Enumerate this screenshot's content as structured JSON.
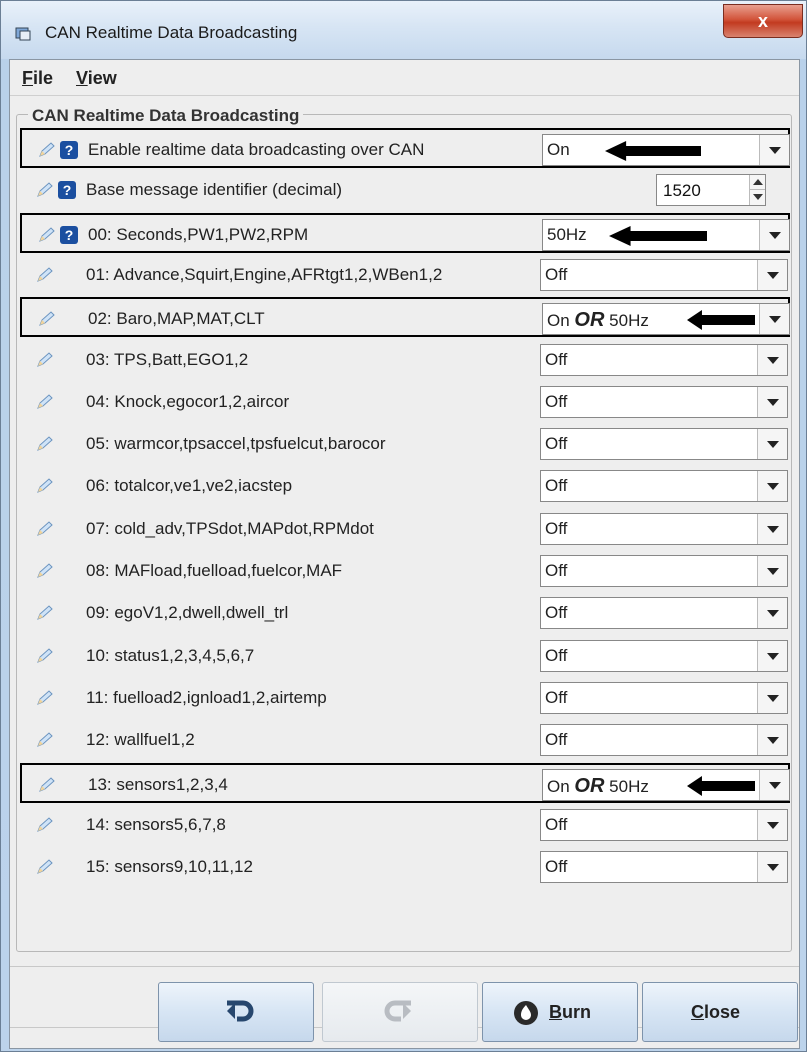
{
  "window": {
    "title": "CAN Realtime Data Broadcasting",
    "close_glyph": "x"
  },
  "menu": {
    "file": {
      "mnemonic": "F",
      "rest": "ile"
    },
    "view": {
      "mnemonic": "V",
      "rest": "iew"
    }
  },
  "section": {
    "title": "CAN Realtime Data Broadcasting"
  },
  "rows": [
    {
      "label": "Enable realtime data broadcasting over CAN",
      "value": "On",
      "has_help": true,
      "highlight": true
    },
    {
      "label": "Base message identifier (decimal)",
      "value": "1520",
      "has_help": true,
      "highlight": false,
      "spinner": true
    },
    {
      "label": "00: Seconds,PW1,PW2,RPM",
      "value": "50Hz",
      "has_help": true,
      "highlight": true
    },
    {
      "label": "01: Advance,Squirt,Engine,AFRtgt1,2,WBen1,2",
      "value": "Off"
    },
    {
      "label": "02: Baro,MAP,MAT,CLT",
      "value_a": "On",
      "value_or": "OR",
      "value_b": "50Hz",
      "highlight": true
    },
    {
      "label": "03: TPS,Batt,EGO1,2",
      "value": "Off"
    },
    {
      "label": "04: Knock,egocor1,2,aircor",
      "value": "Off"
    },
    {
      "label": "05: warmcor,tpsaccel,tpsfuelcut,barocor",
      "value": "Off"
    },
    {
      "label": "06: totalcor,ve1,ve2,iacstep",
      "value": "Off"
    },
    {
      "label": "07: cold_adv,TPSdot,MAPdot,RPMdot",
      "value": "Off"
    },
    {
      "label": "08: MAFload,fuelload,fuelcor,MAF",
      "value": "Off"
    },
    {
      "label": "09: egoV1,2,dwell,dwell_trl",
      "value": "Off"
    },
    {
      "label": "10: status1,2,3,4,5,6,7",
      "value": "Off"
    },
    {
      "label": "11: fuelload2,ignload1,2,airtemp",
      "value": "Off"
    },
    {
      "label": "12: wallfuel1,2",
      "value": "Off"
    },
    {
      "label": "13: sensors1,2,3,4",
      "value_a": "On",
      "value_or": "OR",
      "value_b": "50Hz",
      "highlight": true
    },
    {
      "label": "14: sensors5,6,7,8",
      "value": "Off"
    },
    {
      "label": "15: sensors9,10,11,12",
      "value": "Off"
    }
  ],
  "buttons": {
    "burn": {
      "mnemonic": "B",
      "rest": "urn"
    },
    "close": {
      "mnemonic": "C",
      "rest": "lose"
    }
  },
  "colors": {
    "help_icon": "#1b4fa0",
    "annotation_arrow": "#000000"
  }
}
